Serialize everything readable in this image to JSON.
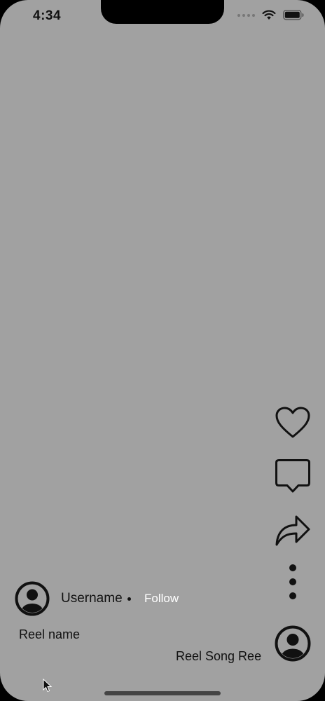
{
  "status_bar": {
    "time": "4:34",
    "icons": [
      "signal-dots-icon",
      "wifi-icon",
      "battery-icon"
    ]
  },
  "reel": {
    "background_color": "#a1a1a1",
    "username": "Username",
    "follow_label": "Follow",
    "reel_name": "Reel name",
    "song_name": "Reel Song Ree"
  },
  "actions": [
    "heart-icon",
    "comment-icon",
    "share-icon",
    "more-options-icon",
    "audio-avatar-icon"
  ],
  "colors": {
    "icon_stroke": "#111111",
    "follow_text": "#ffffff"
  }
}
